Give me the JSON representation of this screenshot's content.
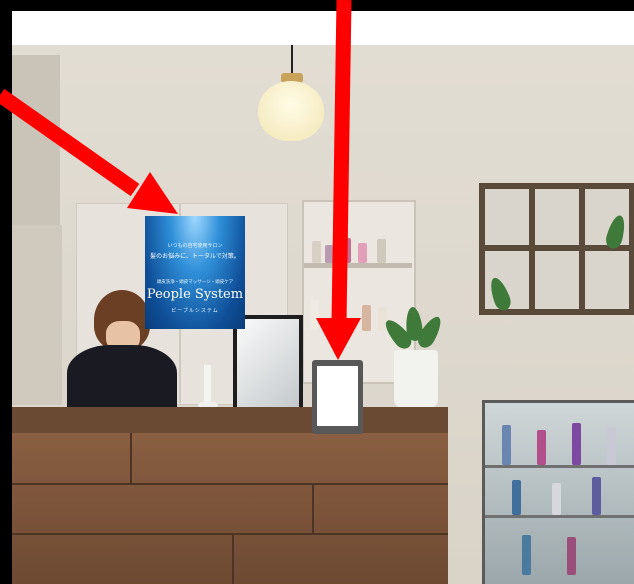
{
  "poster": {
    "tagline": "いつもの自宅使用サロン",
    "headline": "髪のお悩みに、トータルで対策。",
    "services": "頭皮洗浄・頭皮マッサージ・頭皮ケア",
    "brand": "People System",
    "kana": "ピープルシステム"
  },
  "colors": {
    "arrow": "#ff0000",
    "poster": "#1f6fc0",
    "counter": "#7a5238",
    "wall": "#ddd8ce"
  }
}
